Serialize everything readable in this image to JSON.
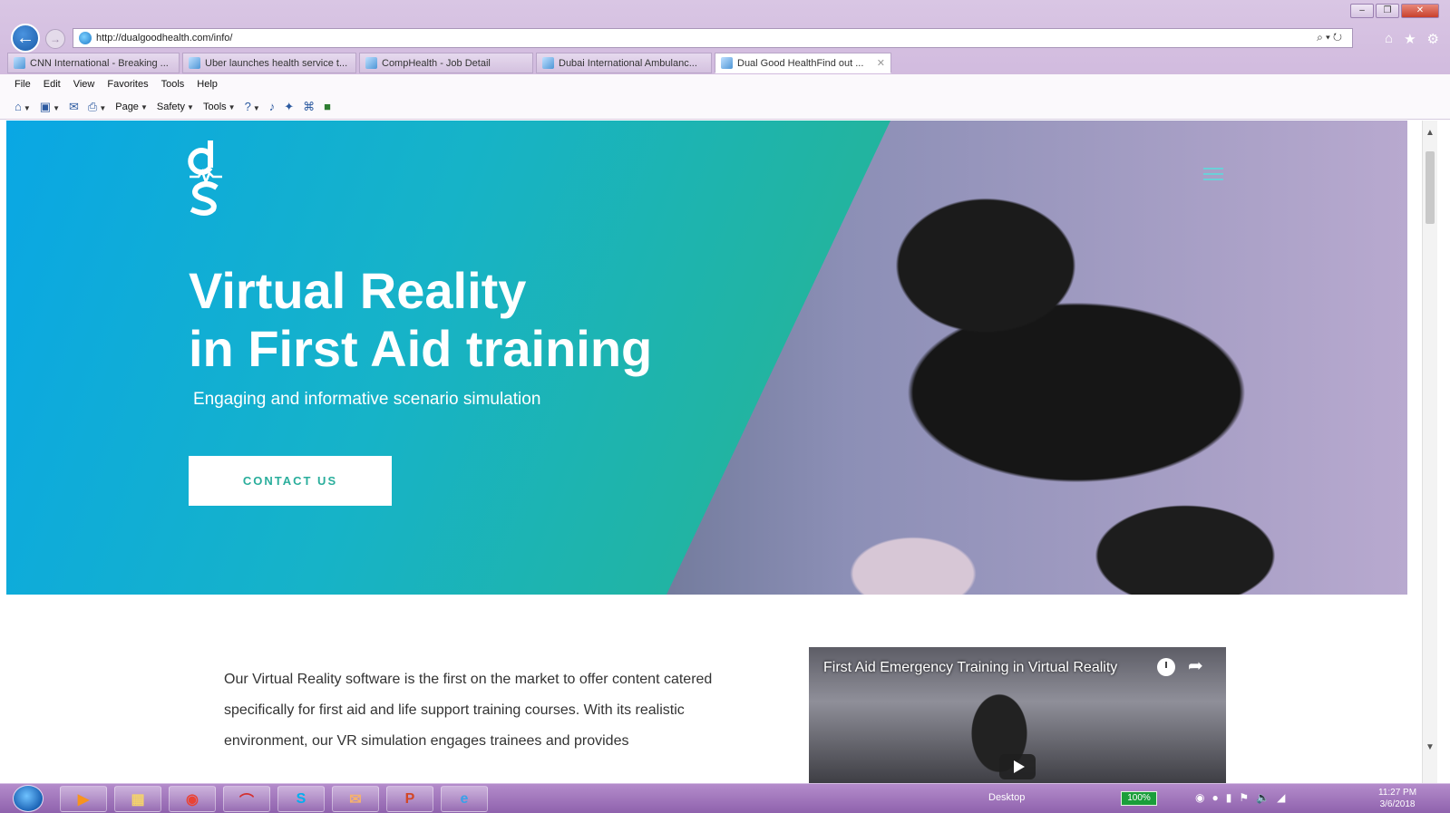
{
  "browser": {
    "url": "http://dualgoodhealth.com/info/",
    "tabs": [
      {
        "label": "CNN International - Breaking ...",
        "active": false
      },
      {
        "label": "Uber launches health service t...",
        "active": false
      },
      {
        "label": "CompHealth - Job Detail",
        "active": false
      },
      {
        "label": "Dubai International Ambulanc...",
        "active": false
      },
      {
        "label": "Dual Good HealthFind out ...",
        "active": true
      }
    ],
    "menu": [
      "File",
      "Edit",
      "View",
      "Favorites",
      "Tools",
      "Help"
    ],
    "commands": {
      "page": "Page",
      "safety": "Safety",
      "tools": "Tools"
    }
  },
  "hero": {
    "title_line1": "Virtual Reality",
    "title_line2": "in First Aid training",
    "subtitle": "Engaging and informative scenario simulation",
    "contact_label": "CONTACT US",
    "accent_color": "#2aae9c"
  },
  "intro": {
    "text": "Our Virtual Reality software is the first on the market to offer content catered specifically for first aid and life support training courses. With its realistic environment, our VR simulation engages trainees and provides"
  },
  "video": {
    "title": "First Aid Emergency Training in Virtual Reality"
  },
  "taskbar": {
    "desktop_label": "Desktop",
    "battery": "100%",
    "time": "11:27 PM",
    "date": "3/6/2018"
  }
}
